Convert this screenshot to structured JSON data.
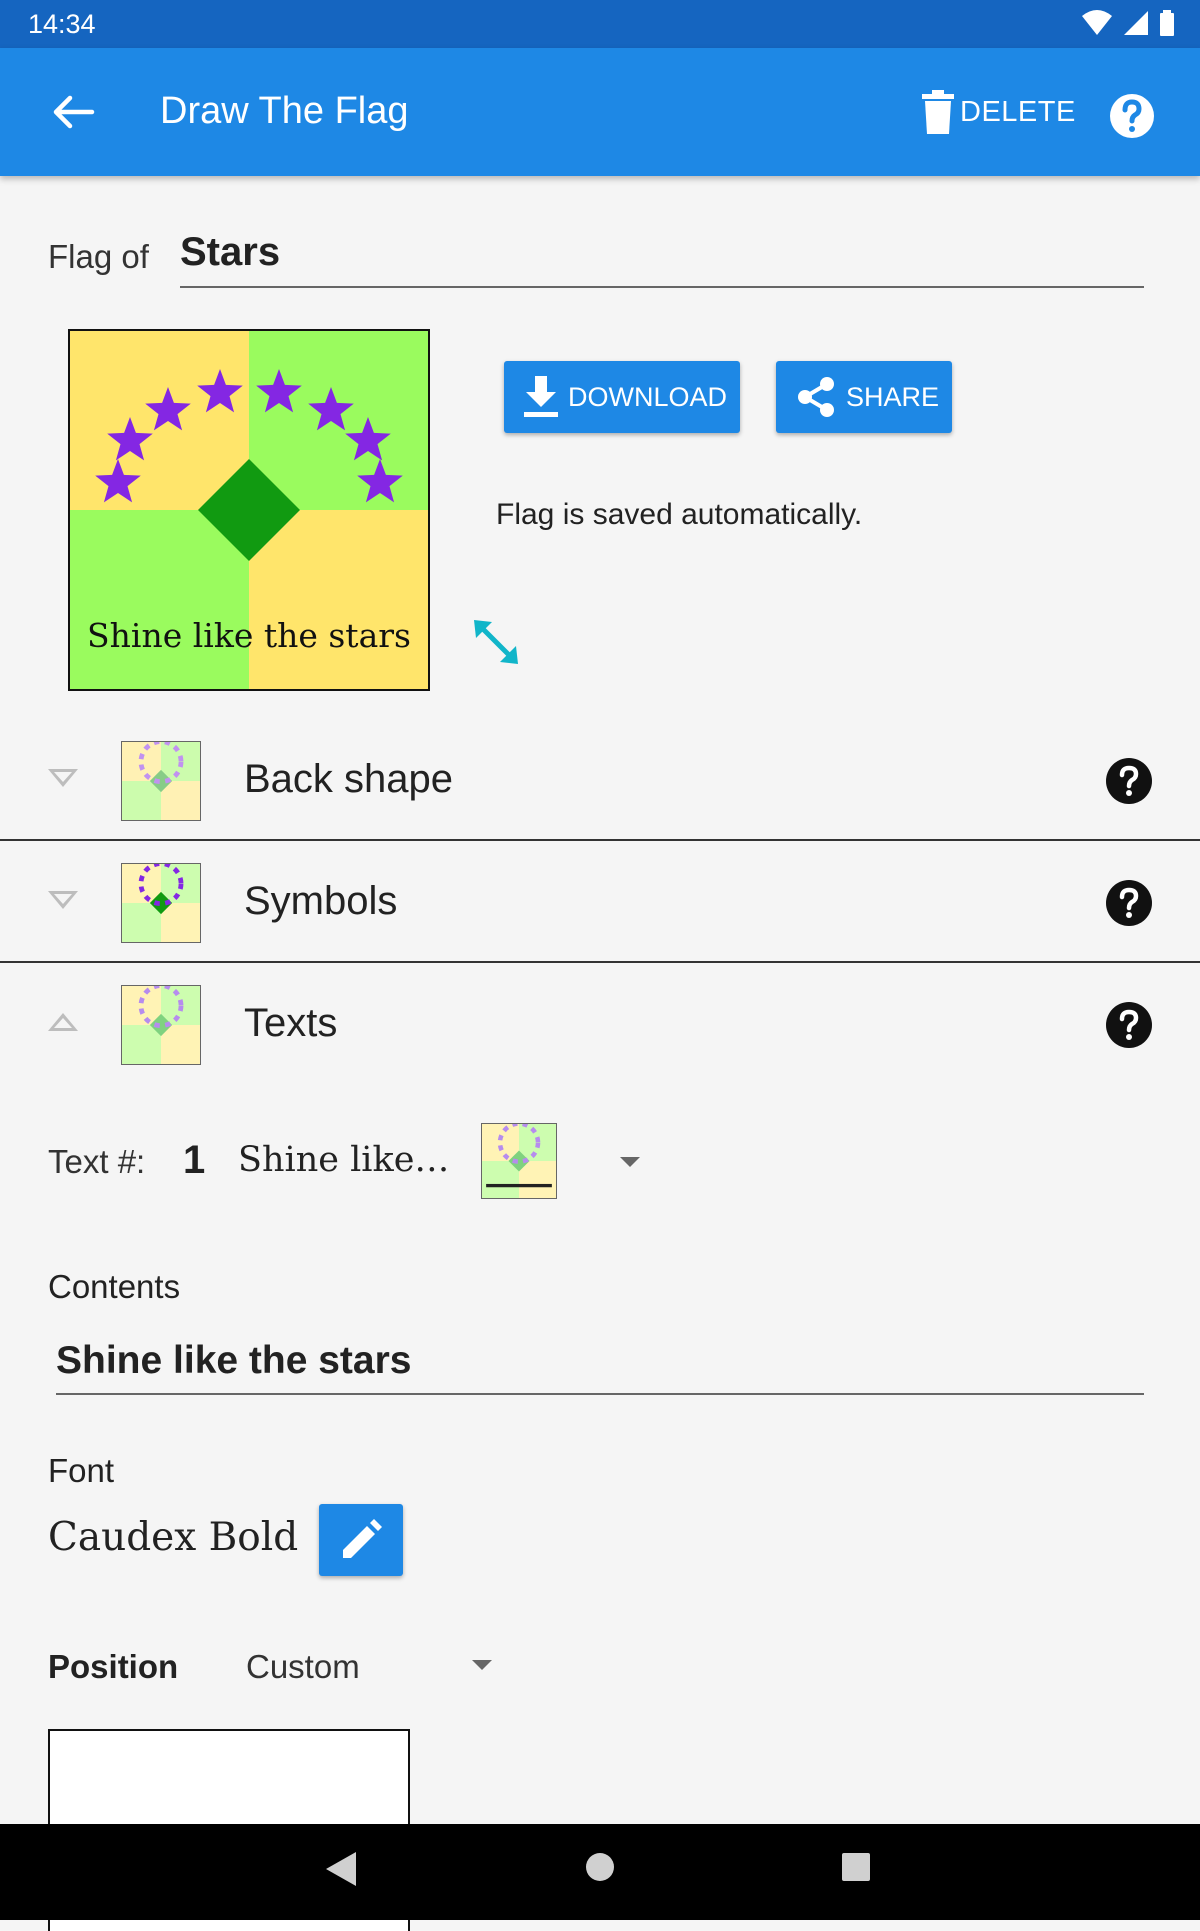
{
  "status": {
    "time": "14:34"
  },
  "appbar": {
    "title": "Draw The Flag",
    "delete_label": "DELETE"
  },
  "flag": {
    "prefix": "Flag of",
    "name": "Stars",
    "motto": "Shine like the stars"
  },
  "actions": {
    "download_label": "DOWNLOAD",
    "share_label": "SHARE",
    "saved_message": "Flag is saved automatically."
  },
  "sections": [
    {
      "label": "Back shape",
      "state": "collapsed"
    },
    {
      "label": "Symbols",
      "state": "collapsed"
    },
    {
      "label": "Texts",
      "state": "expanded"
    }
  ],
  "text_editor": {
    "text_num_label": "Text #:",
    "text_num": "1",
    "text_preview": "Shine like…",
    "contents_label": "Contents",
    "contents_value": "Shine like the stars",
    "font_label": "Font",
    "font_value": "Caudex Bold",
    "position_label": "Position",
    "position_value": "Custom"
  },
  "colors": {
    "primary": "#1e88e5",
    "primary_dark": "#1565c0",
    "flag_yellow": "#ffe56b",
    "flag_green": "#9afb5e",
    "diamond": "#119a11",
    "stars": "#8427e3"
  },
  "icons": [
    "back-arrow-icon",
    "trash-icon",
    "help-icon",
    "download-icon",
    "share-icon",
    "expand-icon",
    "pencil-icon",
    "question-icon",
    "back-nav-icon",
    "home-nav-icon",
    "recents-nav-icon"
  ]
}
